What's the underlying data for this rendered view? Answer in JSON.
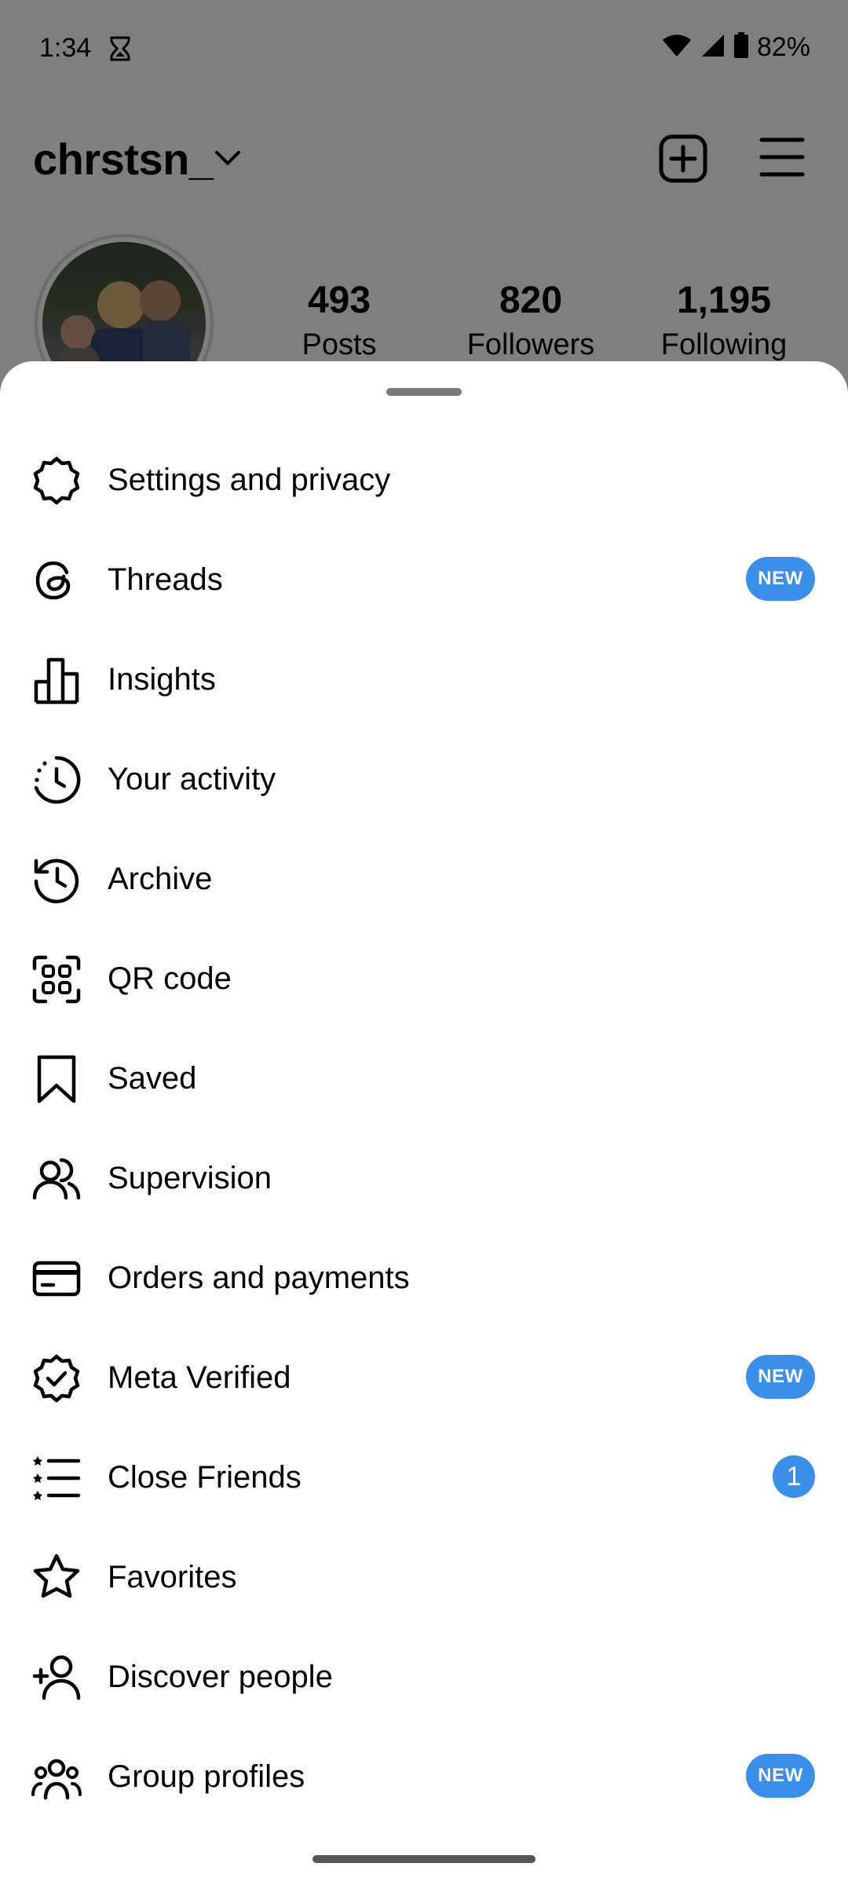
{
  "status_bar": {
    "time": "1:34",
    "battery": "82%"
  },
  "profile": {
    "username": "chrstsn_",
    "stats": [
      {
        "value": "493",
        "label": "Posts"
      },
      {
        "value": "820",
        "label": "Followers"
      },
      {
        "value": "1,195",
        "label": "Following"
      }
    ]
  },
  "menu": {
    "items": [
      {
        "label": "Settings and privacy",
        "icon": "settings-icon"
      },
      {
        "label": "Threads",
        "icon": "threads-icon",
        "badge": "NEW"
      },
      {
        "label": "Insights",
        "icon": "insights-icon"
      },
      {
        "label": "Your activity",
        "icon": "activity-icon"
      },
      {
        "label": "Archive",
        "icon": "archive-icon"
      },
      {
        "label": "QR code",
        "icon": "qr-code-icon"
      },
      {
        "label": "Saved",
        "icon": "bookmark-icon"
      },
      {
        "label": "Supervision",
        "icon": "supervision-icon"
      },
      {
        "label": "Orders and payments",
        "icon": "card-icon"
      },
      {
        "label": "Meta Verified",
        "icon": "verified-badge-icon",
        "badge": "NEW"
      },
      {
        "label": "Close Friends",
        "icon": "close-friends-icon",
        "count": "1"
      },
      {
        "label": "Favorites",
        "icon": "star-icon"
      },
      {
        "label": "Discover people",
        "icon": "add-person-icon"
      },
      {
        "label": "Group profiles",
        "icon": "group-icon",
        "badge": "NEW"
      }
    ]
  },
  "colors": {
    "badge": "#3b8fe8",
    "scrim": "rgba(0,0,0,0.5)"
  }
}
